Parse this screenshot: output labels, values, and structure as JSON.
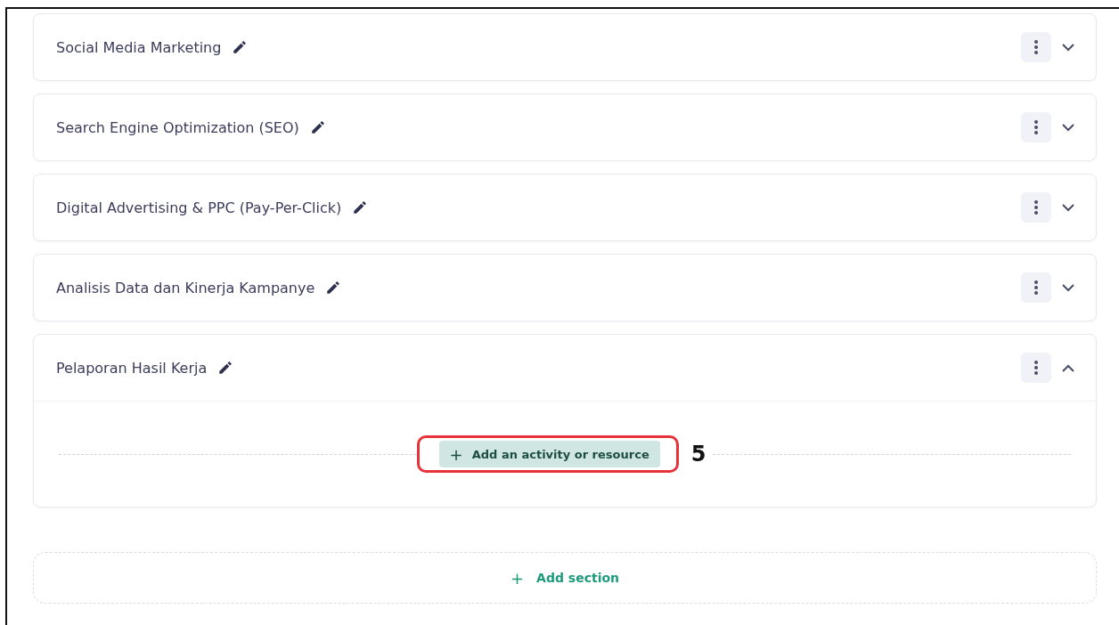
{
  "sections": [
    {
      "title": "Social Media Marketing",
      "expanded": false
    },
    {
      "title": "Search Engine Optimization (SEO)",
      "expanded": false
    },
    {
      "title": "Digital Advertising & PPC (Pay-Per-Click)",
      "expanded": false
    },
    {
      "title": "Analisis Data dan Kinerja Kampanye",
      "expanded": false
    },
    {
      "title": "Pelaporan Hasil Kerja",
      "expanded": true,
      "add_button": {
        "icon": "+",
        "label": "Add an activity or resource"
      },
      "callout": {
        "number": "5"
      }
    }
  ],
  "add_section": {
    "icon": "+",
    "label": "Add section"
  }
}
